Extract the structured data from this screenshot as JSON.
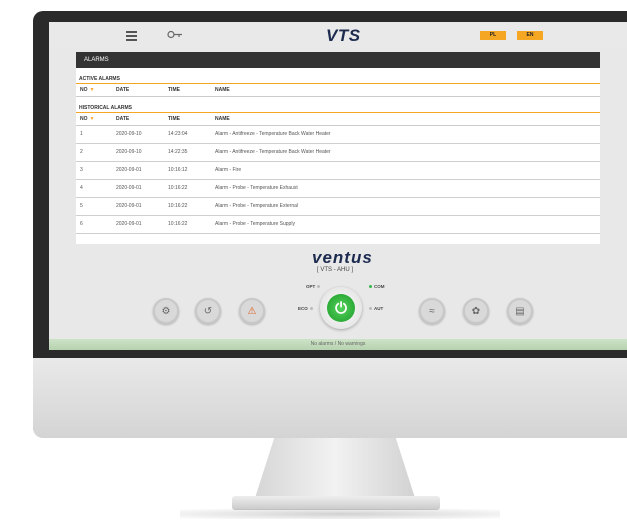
{
  "topbar": {
    "logo": "VTS",
    "languages": [
      "PL",
      "EN"
    ]
  },
  "alarms_panel": {
    "title": "ALARMS",
    "active_section": "ACTIVE ALARMS",
    "historical_section": "HISTORICAL ALARMS",
    "columns": [
      "NO",
      "DATE",
      "TIME",
      "NAME"
    ],
    "historical_rows": [
      {
        "no": "1",
        "date": "2020-09-10",
        "time": "14:23:04",
        "name": "Alarm - Antifreeze - Temperature Back Water Heater"
      },
      {
        "no": "2",
        "date": "2020-09-10",
        "time": "14:22:35",
        "name": "Alarm - Antifreeze - Temperature Back Water Heater"
      },
      {
        "no": "3",
        "date": "2020-09-01",
        "time": "10:16:12",
        "name": "Alarm - Fire"
      },
      {
        "no": "4",
        "date": "2020-09-01",
        "time": "10:16:22",
        "name": "Alarm - Probe - Temperature Exhaust"
      },
      {
        "no": "5",
        "date": "2020-09-01",
        "time": "10:16:22",
        "name": "Alarm - Probe - Temperature External"
      },
      {
        "no": "6",
        "date": "2020-09-01",
        "time": "10:16:22",
        "name": "Alarm - Probe - Temperature Supply"
      }
    ]
  },
  "brand": {
    "name": "ventus",
    "subtitle": "[ VTS - AHU ]"
  },
  "controls": {
    "modes": {
      "opt": "OPT",
      "com": "COM",
      "eco": "ECO",
      "aut": "AUT"
    },
    "power_icon": "power-icon",
    "accent_green": "#2db83d"
  },
  "status_bar": {
    "text": "No alarms / No warnings"
  },
  "colors": {
    "accent": "#f5a623",
    "header_dark": "#333333",
    "brand_navy": "#1d2b4f"
  }
}
